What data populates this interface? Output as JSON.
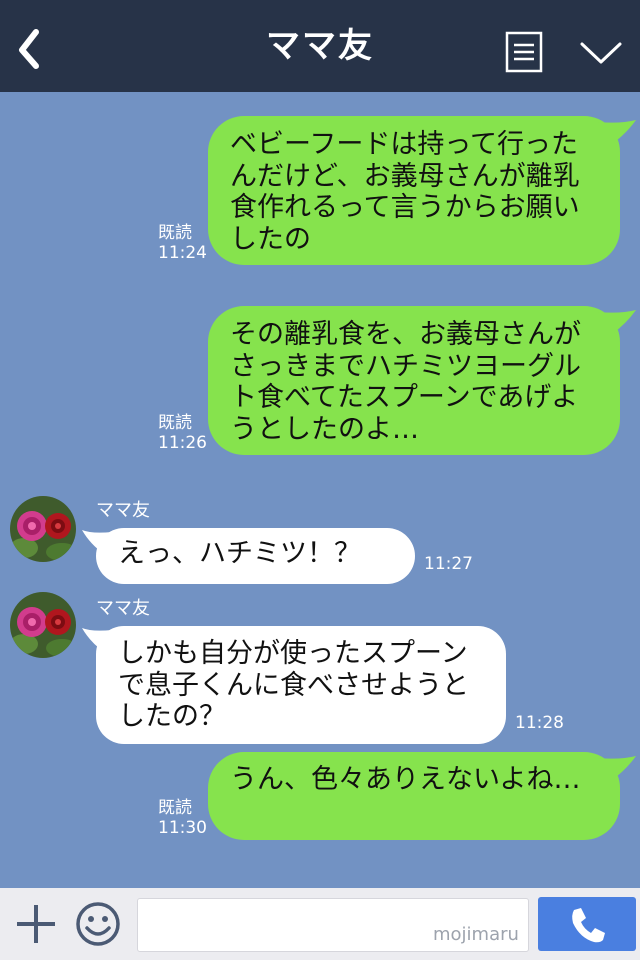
{
  "header": {
    "title": "ママ友",
    "back_icon": "chevron-left-icon",
    "menu_icon": "menu-list-icon",
    "more_icon": "chevron-down-icon"
  },
  "colors": {
    "header_bg": "#273348",
    "chat_bg": "#7292c3",
    "sent_bubble": "#86e34d",
    "received_bubble": "#ffffff",
    "call_button": "#4a7fe0"
  },
  "messages": [
    {
      "text": "ベビーフードは持って行ったんだけど、お義母さんが離乳食作れるって言うからお願いしたの",
      "read": "既読",
      "time": "11:24"
    },
    {
      "text": "その離乳食を、お義母さんがさっきまでハチミツヨーグルト食べてたスプーンであげようとしたのよ…",
      "read": "既読",
      "time": "11:26"
    },
    {
      "sender": "ママ友",
      "text": "えっ、ハチミツ！？",
      "time": "11:27"
    },
    {
      "sender": "ママ友",
      "text": "しかも自分が使ったスプーンで息子くんに食べさせようとしたの？",
      "time": "11:28"
    },
    {
      "text": "うん、色々ありえないよね…",
      "read": "既読",
      "time": "11:30"
    }
  ],
  "footer": {
    "input_value": "",
    "watermark": "mojimaru",
    "add_icon": "plus-icon",
    "sticker_icon": "smiley-icon",
    "call_icon": "phone-icon"
  }
}
